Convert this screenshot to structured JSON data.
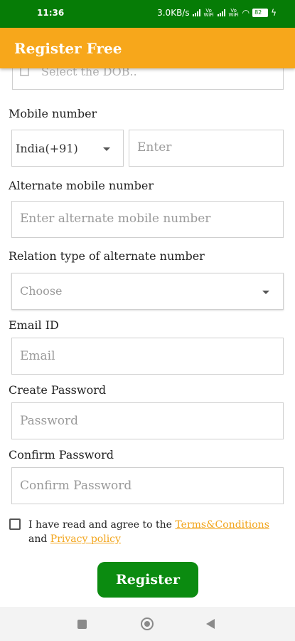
{
  "status_bar": {
    "time": "11:36",
    "network_speed": "3.0KB/s",
    "volte1": "Vo WiFi",
    "volte2": "Vo WiFi",
    "battery": "82"
  },
  "app_bar": {
    "title": "Register Free"
  },
  "dob": {
    "placeholder": "Select the DOB.."
  },
  "mobile": {
    "label": "Mobile number",
    "country": "India(+91)",
    "placeholder": "Enter"
  },
  "alternate_mobile": {
    "label": "Alternate mobile number",
    "placeholder": "Enter alternate mobile number"
  },
  "relation": {
    "label": "Relation type of alternate number",
    "placeholder": "Choose"
  },
  "email": {
    "label": "Email ID",
    "placeholder": "Email"
  },
  "password": {
    "label": "Create Password",
    "placeholder": "Password"
  },
  "confirm_password": {
    "label": "Confirm Password",
    "placeholder": "Confirm Password"
  },
  "agreement": {
    "prefix": "I have read and agree to the ",
    "terms": "Terms&Conditions",
    "and": "and",
    "privacy": "Privacy policy"
  },
  "register_button": "Register",
  "colors": {
    "status_bar": "#067c06",
    "app_bar": "#f7a71b",
    "link": "#f2a51c",
    "button": "#0b8b10"
  }
}
